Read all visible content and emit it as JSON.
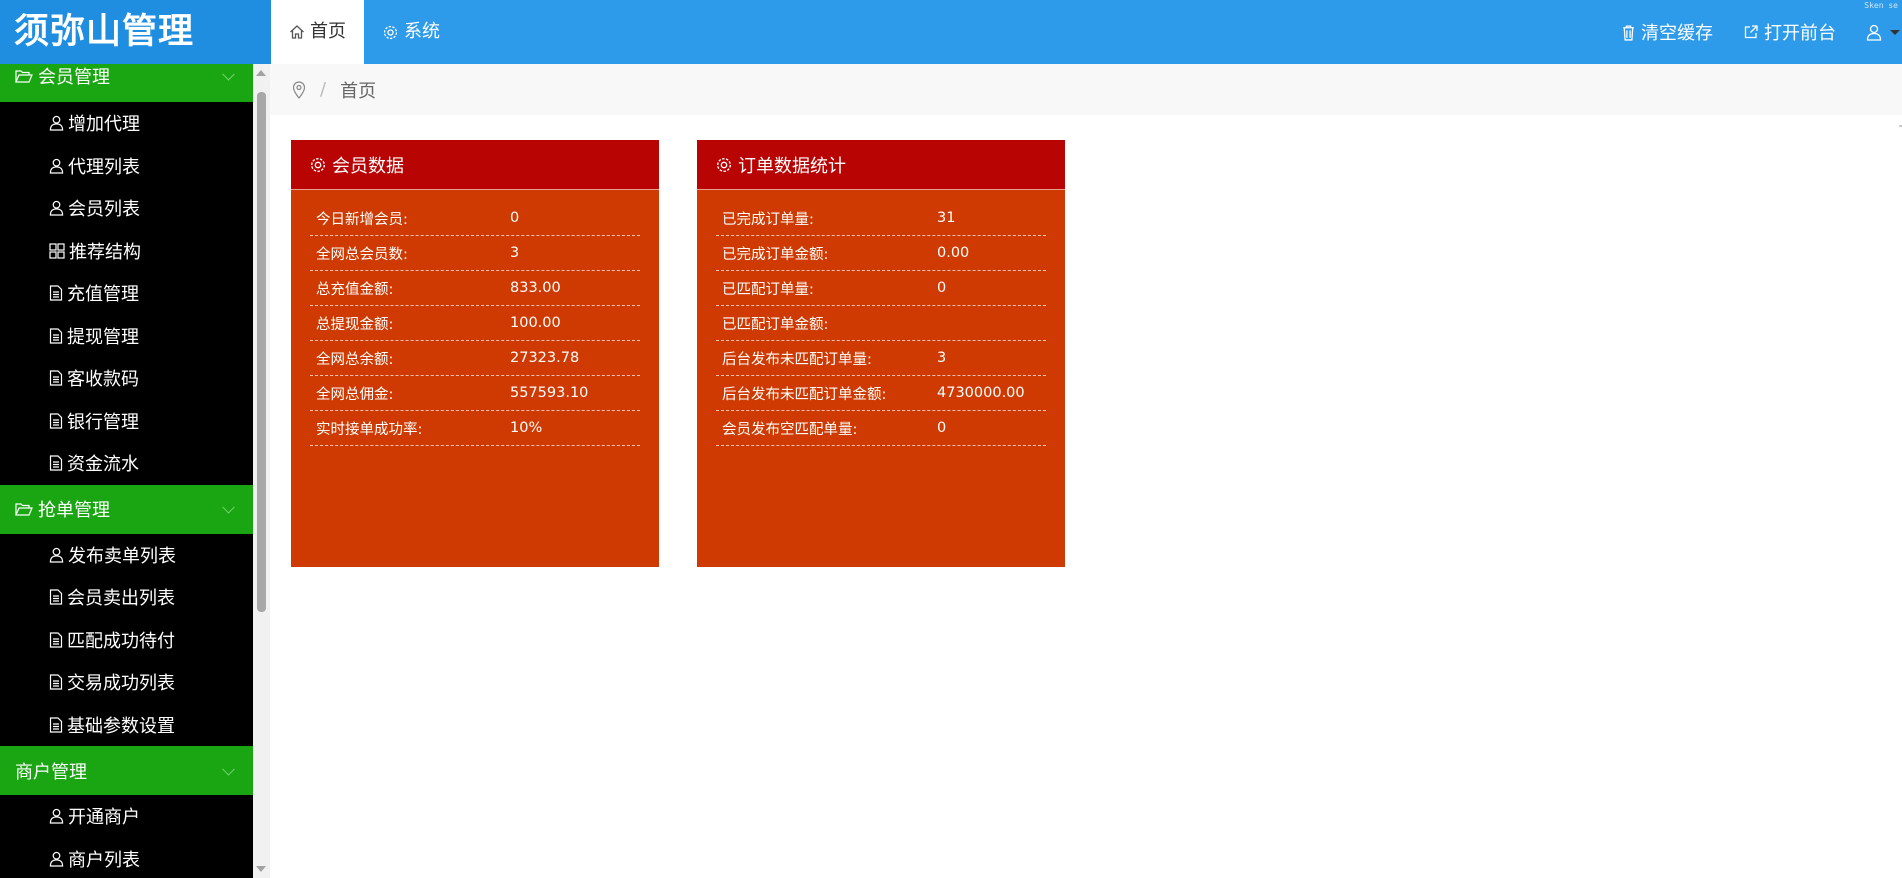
{
  "app": {
    "title": "须弥山管理",
    "watermark": "Sken se"
  },
  "top_nav": {
    "tabs": [
      {
        "label": "首页",
        "icon": "home-icon"
      },
      {
        "label": "系统",
        "icon": "gear-icon"
      }
    ],
    "actions": {
      "clear_cache": "清空缓存",
      "open_frontend": "打开前台"
    }
  },
  "sidebar": {
    "groups": [
      {
        "label": "会员管理",
        "icon": "folder-open-icon",
        "items": [
          {
            "label": "增加代理",
            "icon": "user-icon"
          },
          {
            "label": "代理列表",
            "icon": "user-icon"
          },
          {
            "label": "会员列表",
            "icon": "user-icon"
          },
          {
            "label": "推荐结构",
            "icon": "grid-icon"
          },
          {
            "label": "充值管理",
            "icon": "document-icon"
          },
          {
            "label": "提现管理",
            "icon": "document-icon"
          },
          {
            "label": "客收款码",
            "icon": "document-icon"
          },
          {
            "label": "银行管理",
            "icon": "document-icon"
          },
          {
            "label": "资金流水",
            "icon": "document-icon"
          }
        ]
      },
      {
        "label": "抢单管理",
        "icon": "folder-open-icon",
        "items": [
          {
            "label": "发布卖单列表",
            "icon": "user-icon"
          },
          {
            "label": "会员卖出列表",
            "icon": "document-icon"
          },
          {
            "label": "匹配成功待付",
            "icon": "document-icon"
          },
          {
            "label": "交易成功列表",
            "icon": "document-icon"
          },
          {
            "label": "基础参数设置",
            "icon": "document-icon"
          }
        ]
      },
      {
        "label": "商户管理",
        "icon": "",
        "items": [
          {
            "label": "开通商户",
            "icon": "user-icon"
          },
          {
            "label": "商户列表",
            "icon": "user-icon"
          }
        ]
      }
    ]
  },
  "breadcrumb": {
    "separator": "/",
    "current": "首页"
  },
  "panels": {
    "members": {
      "title": "会员数据",
      "rows": [
        {
          "label": "今日新增会员:",
          "value": "0"
        },
        {
          "label": "全网总会员数:",
          "value": "3"
        },
        {
          "label": "总充值金额:",
          "value": "833.00"
        },
        {
          "label": "总提现金额:",
          "value": "100.00"
        },
        {
          "label": "全网总余额:",
          "value": "27323.78"
        },
        {
          "label": "全网总佣金:",
          "value": "557593.10"
        },
        {
          "label": "实时接单成功率:",
          "value": "10%"
        }
      ]
    },
    "orders": {
      "title": "订单数据统计",
      "rows": [
        {
          "label": "已完成订单量:",
          "value": "31"
        },
        {
          "label": "已完成订单金额:",
          "value": "0.00"
        },
        {
          "label": "已匹配订单量:",
          "value": "0"
        },
        {
          "label": "已匹配订单金额:",
          "value": ""
        },
        {
          "label": "后台发布未匹配订单量:",
          "value": "3"
        },
        {
          "label": "后台发布未匹配订单金额:",
          "value": "4730000.00"
        },
        {
          "label": "会员发布空匹配单量:",
          "value": "0"
        }
      ]
    }
  },
  "colors": {
    "header": "#2d9bea",
    "logo_bg": "#1f8ee0",
    "sidebar_bg": "#000000",
    "sidebar_group": "#1aa512",
    "panel_head": "#b90404",
    "panel_body": "#cf3a02"
  }
}
